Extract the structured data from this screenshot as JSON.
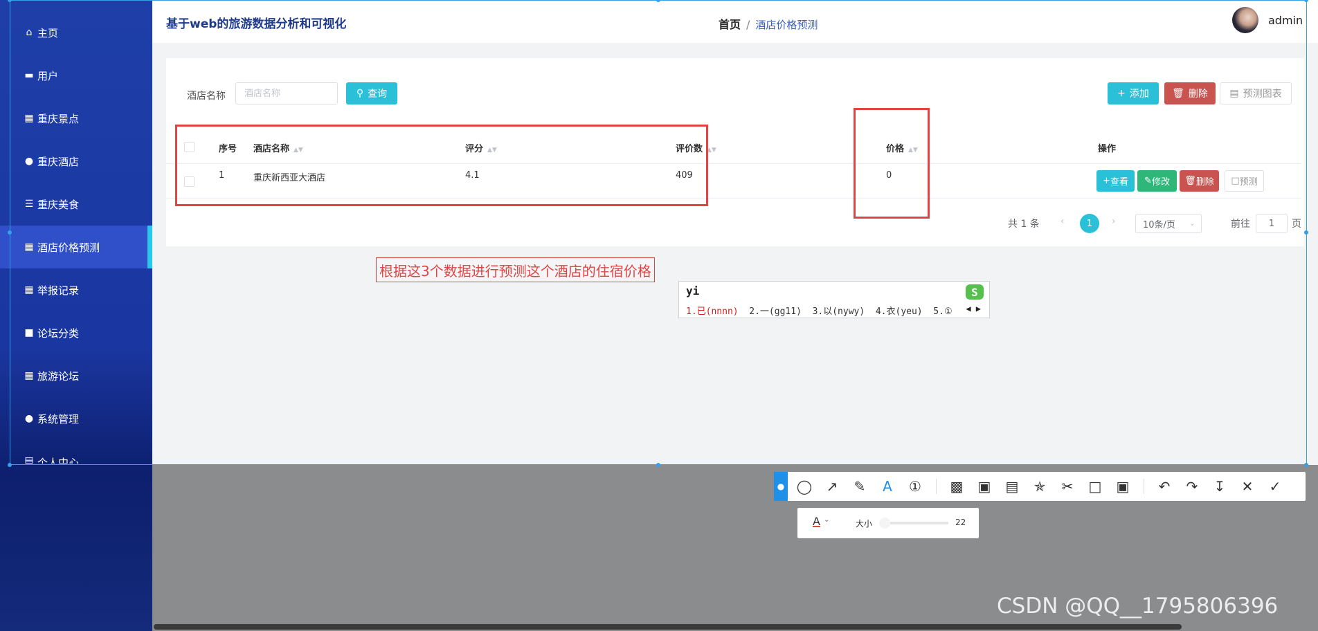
{
  "header": {
    "app_title": "基于web的旅游数据分析和可视化",
    "breadcrumb_home": "首页",
    "breadcrumb_sep": "/",
    "breadcrumb_current": "酒店价格预测",
    "username": "admin"
  },
  "sidebar": {
    "items": [
      {
        "label": "主页",
        "icon": "home-icon",
        "glyph": "⌂"
      },
      {
        "label": "用户",
        "icon": "monitor-icon",
        "glyph": "▬"
      },
      {
        "label": "重庆景点",
        "icon": "grid-icon",
        "glyph": "▦"
      },
      {
        "label": "重庆酒店",
        "icon": "person-icon",
        "glyph": "●"
      },
      {
        "label": "重庆美食",
        "icon": "list-icon",
        "glyph": "☰"
      },
      {
        "label": "酒店价格预测",
        "icon": "grid-icon",
        "glyph": "▦"
      },
      {
        "label": "举报记录",
        "icon": "grid-icon",
        "glyph": "▦"
      },
      {
        "label": "论坛分类",
        "icon": "folder-icon",
        "glyph": "■"
      },
      {
        "label": "旅游论坛",
        "icon": "table-icon",
        "glyph": "▦"
      },
      {
        "label": "系统管理",
        "icon": "person-icon",
        "glyph": "●"
      },
      {
        "label": "个人中心",
        "icon": "id-card-icon",
        "glyph": "▤"
      }
    ]
  },
  "search": {
    "label": "酒店名称",
    "placeholder": "酒店名称",
    "button": "查询"
  },
  "actions": {
    "add": "添加",
    "delete": "删除",
    "chart": "预测图表"
  },
  "table": {
    "headers": {
      "index": "序号",
      "name": "酒店名称",
      "rating": "评分",
      "reviews": "评价数",
      "price": "价格",
      "ops": "操作"
    },
    "rows": [
      {
        "index": "1",
        "name": "重庆新西亚大酒店",
        "rating": "4.1",
        "reviews": "409",
        "price": "0"
      }
    ],
    "row_buttons": {
      "view": "查看",
      "edit": "修改",
      "delete": "删除",
      "predict": "预测"
    }
  },
  "pagination": {
    "total": "共 1 条",
    "current": "1",
    "page_size": "10条/页",
    "goto_label": "前往",
    "goto_value": "1",
    "goto_unit": "页"
  },
  "annotation": {
    "text": "根据这3个数据进行预测这个酒店的住宿价格"
  },
  "ime": {
    "input": "yi",
    "candidates": {
      "c1": "1.已(nnnn)",
      "c2": "2.一(gg11)",
      "c3": "3.以(nywy)",
      "c4": "4.衣(yeu)",
      "c5": "5.①"
    },
    "logo": "S"
  },
  "screenshot_tool": {
    "text_size_label": "大小",
    "text_size_value": "22",
    "text_size_level": 22
  },
  "colors": {
    "accent": "#29c0d8",
    "danger": "#c9534f",
    "success": "#2fb77a",
    "annotation": "#e04545",
    "sidebar": "#1f3fa8"
  },
  "watermark": "CSDN @QQ__1795806396"
}
